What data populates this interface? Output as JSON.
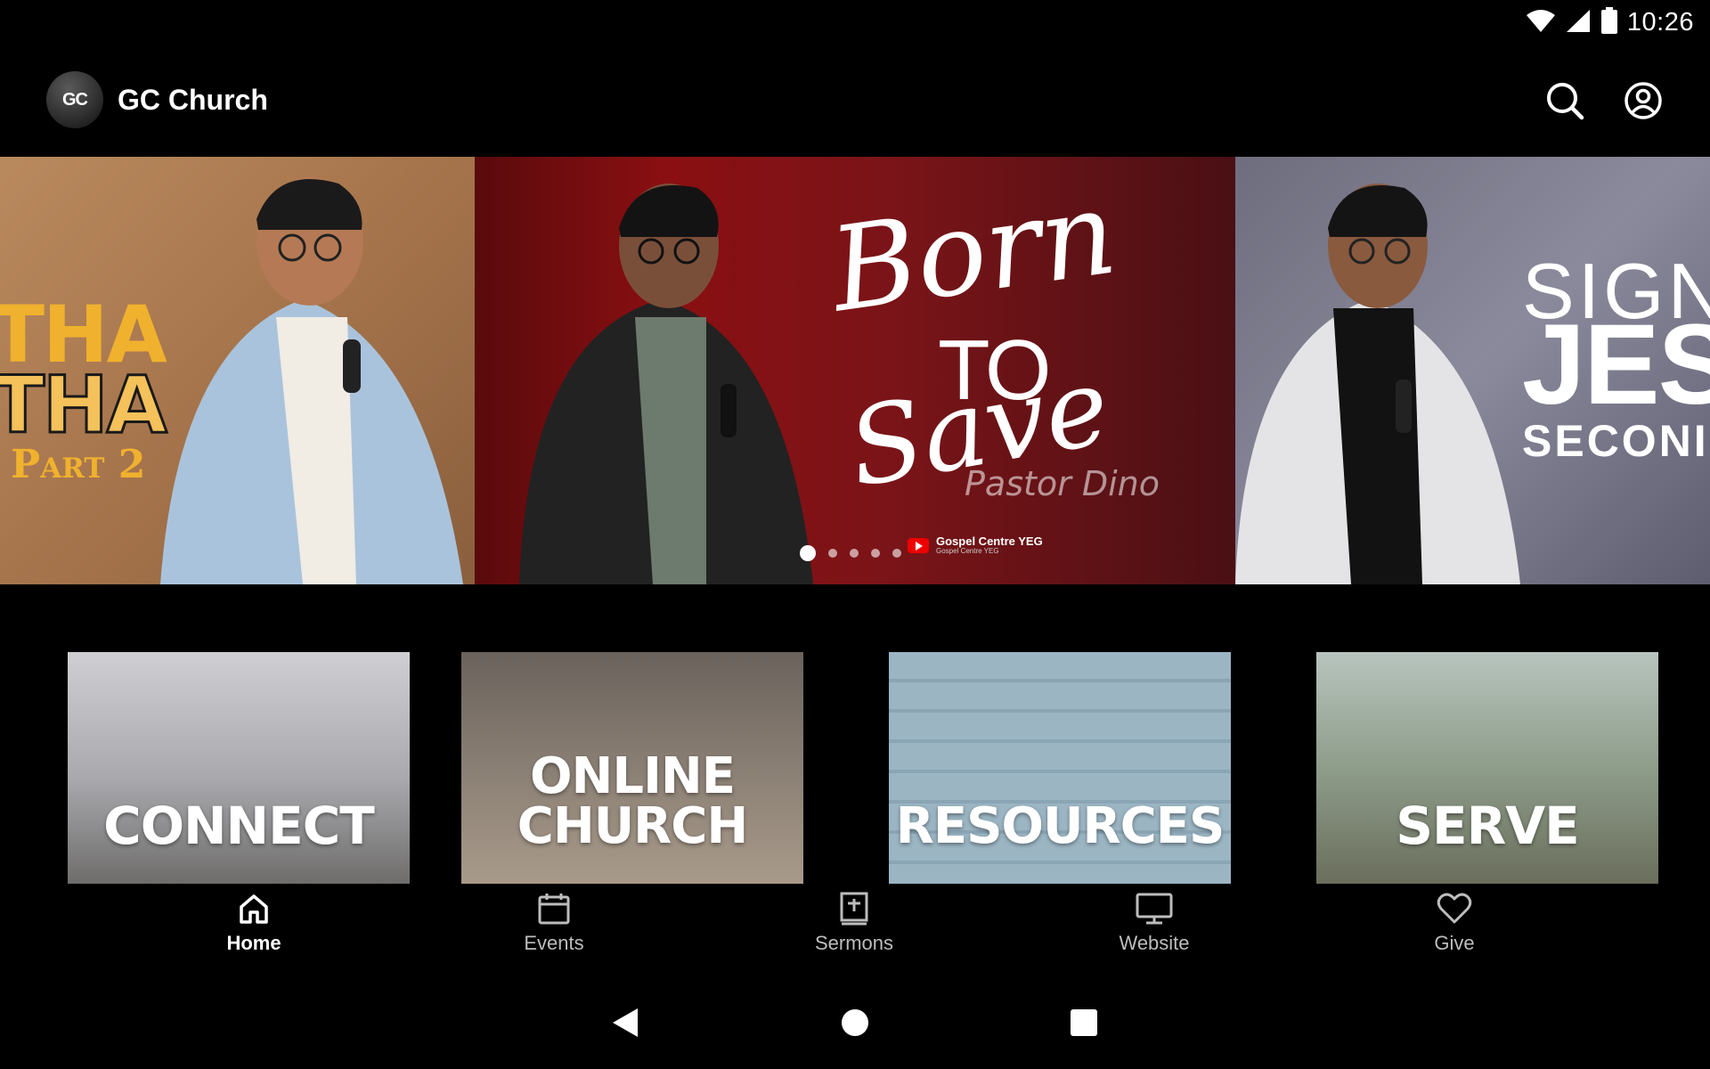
{
  "status_bar": {
    "time": "10:26"
  },
  "app_bar": {
    "logo_text": "GC",
    "title": "GC Church"
  },
  "carousel": {
    "slides": [
      {
        "title_line1": "THA",
        "title_line2": "THA",
        "subtitle": "Part 2"
      },
      {
        "script_title": "Born",
        "middle": "TO",
        "script_title2": "Save",
        "speaker": "Pastor Dino",
        "channel": "Gospel Centre YEG",
        "channel_sub": "Gospel Centre YEG"
      },
      {
        "line1": "SIGN",
        "line2": "JES",
        "line3": "SECONI"
      }
    ],
    "dot_count": 5,
    "active_dot": 0
  },
  "tiles": [
    {
      "label": "CONNECT"
    },
    {
      "label_line1": "ONLINE",
      "label_line2": "CHURCH"
    },
    {
      "label": "RESOURCES"
    },
    {
      "label": "SERVE"
    }
  ],
  "bottom_nav": [
    {
      "label": "Home",
      "icon": "home-icon",
      "active": true
    },
    {
      "label": "Events",
      "icon": "calendar-icon",
      "active": false
    },
    {
      "label": "Sermons",
      "icon": "bible-icon",
      "active": false
    },
    {
      "label": "Website",
      "icon": "monitor-icon",
      "active": false
    },
    {
      "label": "Give",
      "icon": "heart-icon",
      "active": false
    }
  ],
  "colors": {
    "background": "#000000",
    "accent_gold": "#f0b12e",
    "nav_inactive": "#bdbdbd"
  }
}
